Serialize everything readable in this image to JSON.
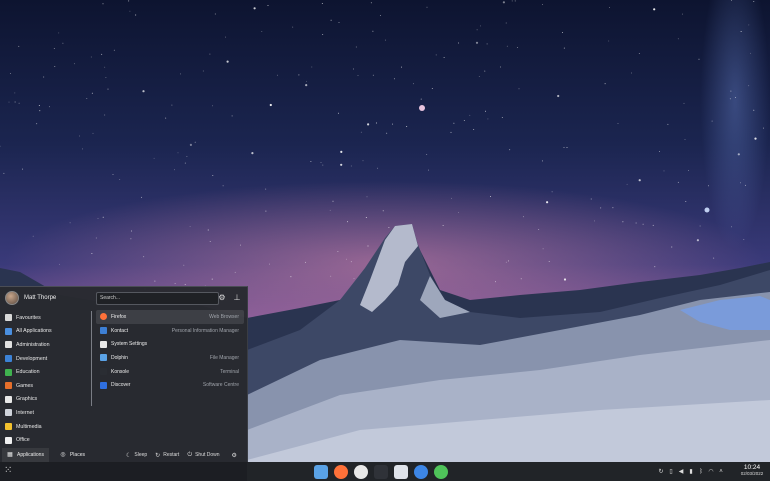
{
  "colors": {
    "menu_bg": "#282a30",
    "taskbar_bg": "#1c1e22",
    "selection": "#3a3c42"
  },
  "menu": {
    "user_name": "Matt Thorpe",
    "search_placeholder": "Search...",
    "header_icons": [
      "settings-icon",
      "pin-icon"
    ],
    "categories": [
      {
        "label": "Favourites",
        "icon": "favourites-icon",
        "color": "#d8d8d8"
      },
      {
        "label": "All Applications",
        "icon": "all-apps-icon",
        "color": "#4a8fe0"
      },
      {
        "label": "Administration",
        "icon": "administration-icon",
        "color": "#e0e0e0"
      },
      {
        "label": "Development",
        "icon": "development-icon",
        "color": "#3c82d6"
      },
      {
        "label": "Education",
        "icon": "education-icon",
        "color": "#3fb24f"
      },
      {
        "label": "Games",
        "icon": "games-icon",
        "color": "#e66f2b"
      },
      {
        "label": "Graphics",
        "icon": "graphics-icon",
        "color": "#e8e8e8"
      },
      {
        "label": "Internet",
        "icon": "internet-icon",
        "color": "#cfd3da"
      },
      {
        "label": "Multimedia",
        "icon": "multimedia-icon",
        "color": "#f2c12e"
      },
      {
        "label": "Office",
        "icon": "office-icon",
        "color": "#f0f0f0"
      }
    ],
    "apps": [
      {
        "name": "Firefox",
        "description": "Web Browser",
        "icon": "firefox-icon",
        "color": "#ff7139"
      },
      {
        "name": "Kontact",
        "description": "Personal Information Manager",
        "icon": "kontact-icon",
        "color": "#3d7fd4"
      },
      {
        "name": "System Settings",
        "description": "",
        "icon": "system-settings-icon",
        "color": "#e8e8e8"
      },
      {
        "name": "Dolphin",
        "description": "File Manager",
        "icon": "dolphin-icon",
        "color": "#5aa2e6"
      },
      {
        "name": "Konsole",
        "description": "Terminal",
        "icon": "konsole-icon",
        "color": "#2a2d33"
      },
      {
        "name": "Discover",
        "description": "Software Centre",
        "icon": "discover-icon",
        "color": "#2f6fe0"
      }
    ],
    "footer": {
      "tabs": [
        {
          "label": "Applications",
          "icon": "applications-grid-icon"
        },
        {
          "label": "Places",
          "icon": "places-compass-icon"
        }
      ],
      "actions": [
        {
          "label": "Sleep",
          "icon": "sleep-moon-icon"
        },
        {
          "label": "Restart",
          "icon": "restart-icon"
        },
        {
          "label": "Shut Down",
          "icon": "power-icon"
        }
      ],
      "more_icon": "leave-menu-icon"
    }
  },
  "taskbar": {
    "launcher_icon": "app-launcher-grid-icon",
    "tasks": [
      {
        "icon": "file-manager-icon",
        "color": "#5aa2e6"
      },
      {
        "icon": "firefox-icon",
        "color": "#ff7139"
      },
      {
        "icon": "chrome-icon",
        "color": "#e8e8e8"
      },
      {
        "icon": "terminal-icon",
        "color": "#2f3238"
      },
      {
        "icon": "text-editor-icon",
        "color": "#dfe3ea"
      },
      {
        "icon": "browser-icon",
        "color": "#3d86e6"
      },
      {
        "icon": "software-updates-icon",
        "color": "#4fc35a"
      }
    ],
    "tray_icons": [
      "updates-tray-icon",
      "clipboard-tray-icon",
      "volume-tray-icon",
      "battery-tray-icon",
      "bluetooth-tray-icon",
      "wifi-tray-icon",
      "expand-tray-icon"
    ],
    "clock_time": "10:24",
    "clock_date": "02/03/2022"
  }
}
